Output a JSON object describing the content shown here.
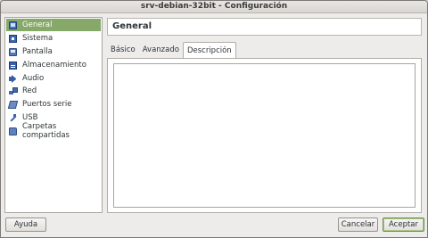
{
  "window": {
    "title": "srv-debian-32bit - Configuración"
  },
  "sidebar": {
    "items": [
      {
        "label": "General",
        "icon": "monitor-icon",
        "selected": true
      },
      {
        "label": "Sistema",
        "icon": "chip-icon",
        "selected": false
      },
      {
        "label": "Pantalla",
        "icon": "display-icon",
        "selected": false
      },
      {
        "label": "Almacenamiento",
        "icon": "storage-icon",
        "selected": false
      },
      {
        "label": "Audio",
        "icon": "speaker-icon",
        "selected": false
      },
      {
        "label": "Red",
        "icon": "network-icon",
        "selected": false
      },
      {
        "label": "Puertos serie",
        "icon": "serial-port-icon",
        "selected": false
      },
      {
        "label": "USB",
        "icon": "usb-icon",
        "selected": false
      },
      {
        "label": "Carpetas compartidas",
        "icon": "folder-icon",
        "selected": false
      }
    ]
  },
  "main": {
    "header": "General",
    "tabs": [
      {
        "label": "Básico",
        "active": false
      },
      {
        "label": "Avanzado",
        "active": false
      },
      {
        "label": "Descripción",
        "active": true
      }
    ],
    "description_value": ""
  },
  "buttons": {
    "help": "Ayuda",
    "cancel": "Cancelar",
    "accept": "Aceptar"
  },
  "colors": {
    "selection": "#86a869",
    "window_bg": "#edeceb"
  }
}
